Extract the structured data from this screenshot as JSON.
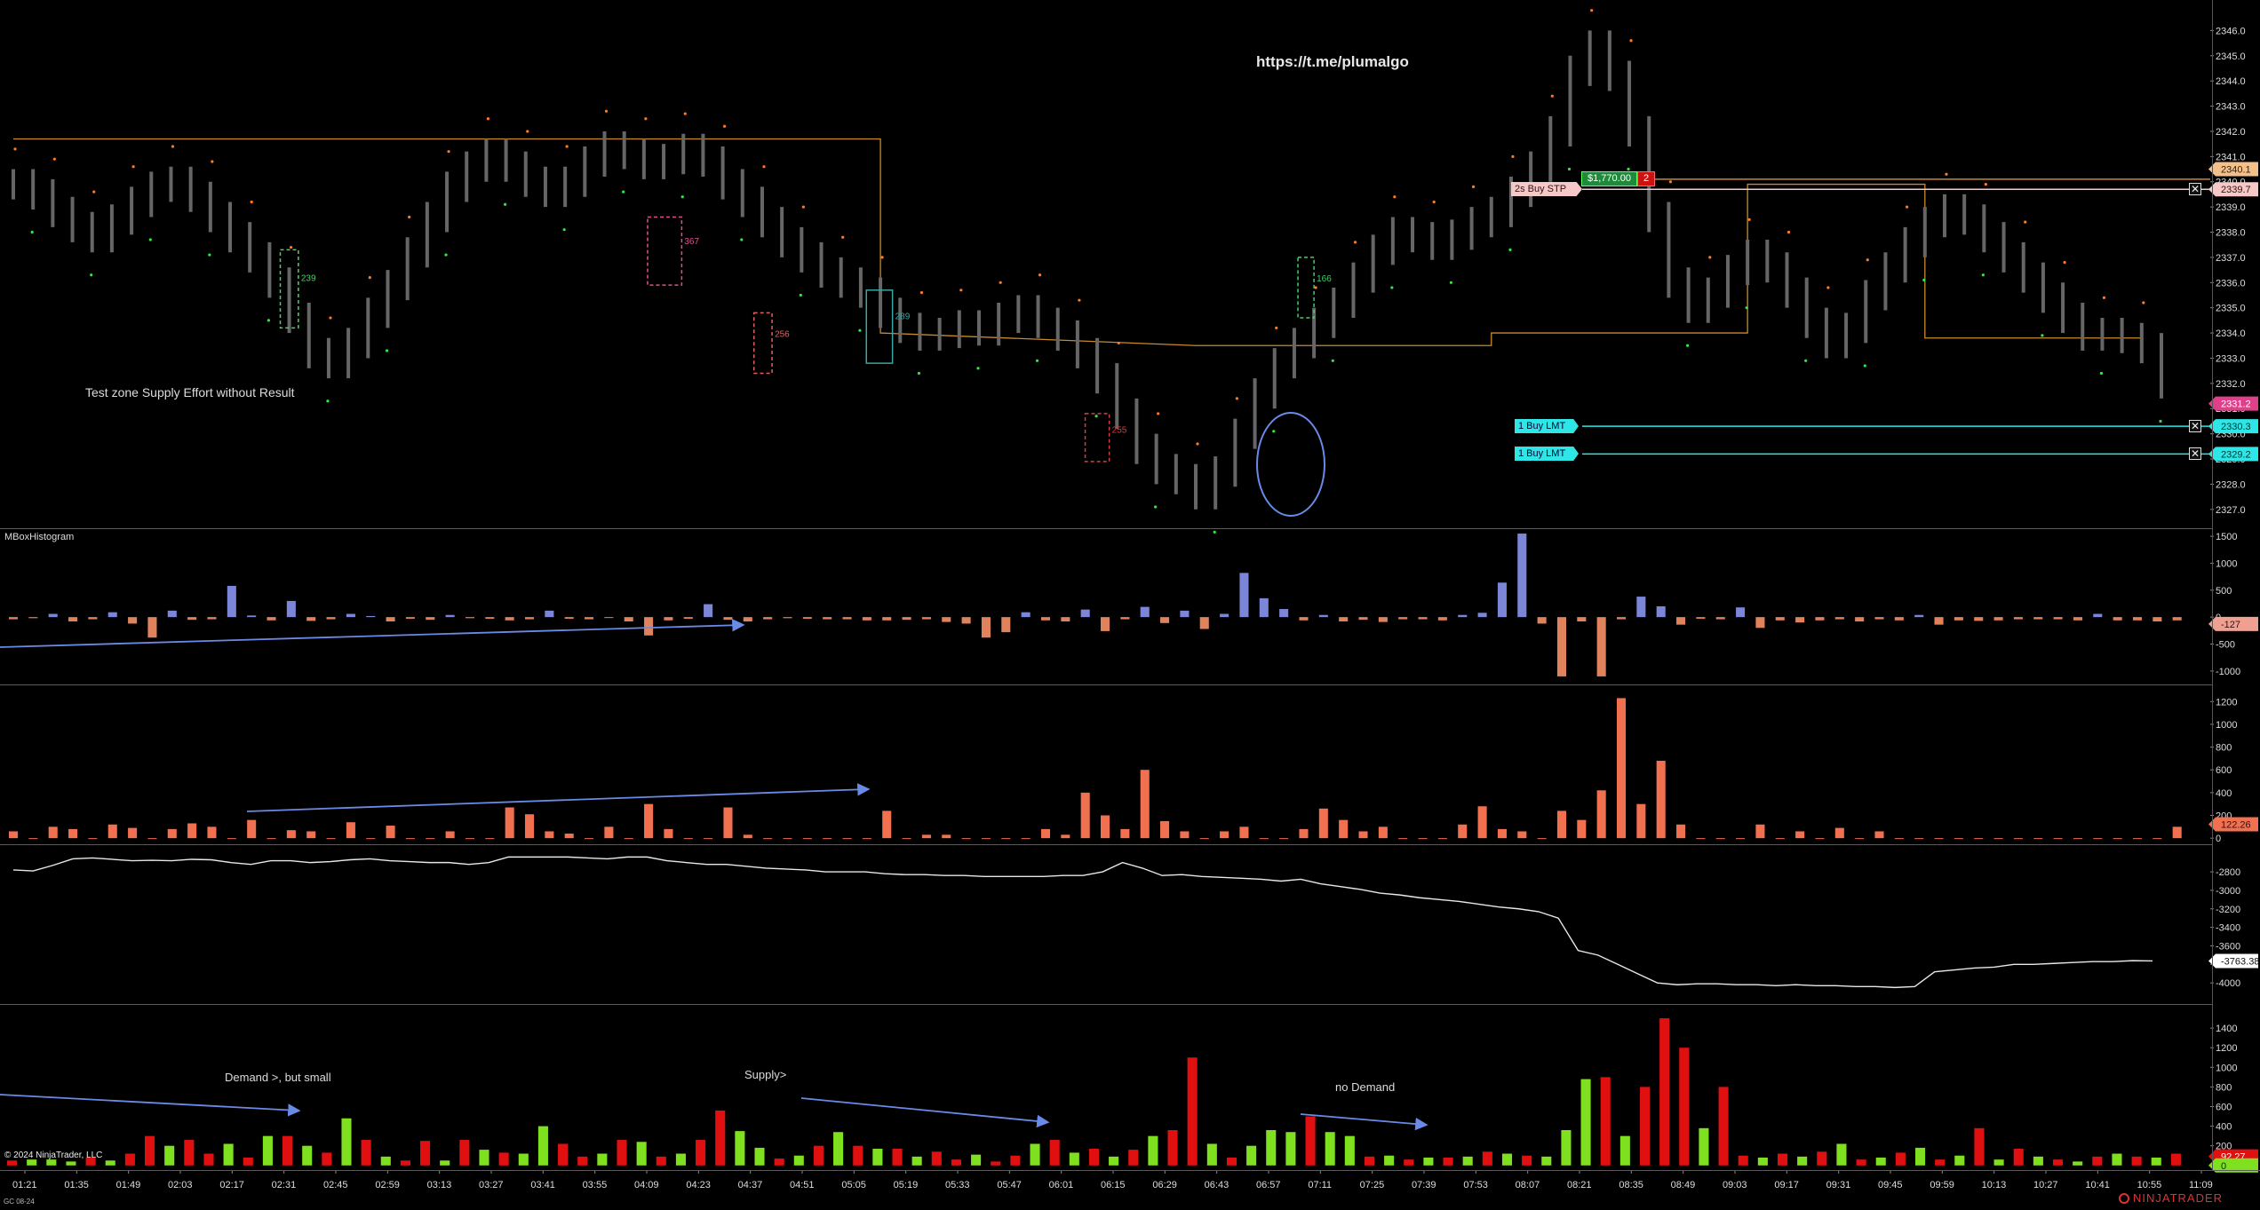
{
  "watermark_url": "https://t.me/plumalgo",
  "copyright": "© 2024 NinjaTrader, LLC",
  "brand": "NINJATRADER",
  "instrument": "GC 08-24",
  "annotations": {
    "test_zone": "Test zone Supply Effort without Result",
    "demand_small": "Demand >, but small",
    "supply": "Supply>",
    "no_demand": "no Demand"
  },
  "orders": {
    "buy_stp": {
      "label": "2s  Buy STP",
      "price": "2339.7"
    },
    "buy_lmt_1": {
      "label": "1  Buy LMT",
      "price": "2330.3"
    },
    "buy_lmt_2": {
      "label": "1  Buy LMT",
      "price": "2329.2"
    },
    "pnl": "$1,770.00",
    "qty": "2",
    "stop_tag": "2340.1",
    "last_tag": "2331.2",
    "close_symbol": "✕"
  },
  "colors": {
    "accent_green": "#7fe020",
    "accent_red": "#e01010",
    "delta_pos": "#7b86d8",
    "delta_neg": "#e0825c",
    "vol_bar": "#f07050",
    "order_cyan": "#2ee6e6",
    "level_line": "#c98a2a"
  },
  "chart_data": [
    {
      "type": "line",
      "panel": "price",
      "ylim": [
        2326.5,
        2347
      ],
      "y_ticks": [
        "2327.0",
        "2328.0",
        "2329.0",
        "2330.0",
        "2331.0",
        "2332.0",
        "2333.0",
        "2334.0",
        "2335.0",
        "2336.0",
        "2337.0",
        "2338.0",
        "2339.0",
        "2340.0",
        "2341.0",
        "2342.0",
        "2343.0",
        "2344.0",
        "2345.0",
        "2346.0"
      ],
      "x_ticks": [
        "01:21",
        "01:35",
        "01:49",
        "02:03",
        "02:17",
        "02:31",
        "02:45",
        "02:59",
        "03:13",
        "03:27",
        "03:41",
        "03:55",
        "04:09",
        "04:23",
        "04:37",
        "04:51",
        "05:05",
        "05:19",
        "05:33",
        "05:47",
        "06:01",
        "06:15",
        "06:29",
        "06:43",
        "06:57",
        "07:11",
        "07:25",
        "07:39",
        "07:53",
        "08:07",
        "08:21",
        "08:35",
        "08:49",
        "09:03",
        "09:17",
        "09:31",
        "09:45",
        "09:59",
        "10:13",
        "10:27",
        "10:41",
        "10:55",
        "11:09"
      ],
      "close": [
        2339.9,
        2339.5,
        2338.8,
        2338.2,
        2337.8,
        2338.5,
        2339.2,
        2339.8,
        2340.0,
        2339.4,
        2338.6,
        2337.8,
        2337.0,
        2336.0,
        2334.6,
        2333.2,
        2332.8,
        2333.6,
        2334.8,
        2335.9,
        2337.2,
        2338.6,
        2339.8,
        2340.6,
        2341.1,
        2340.6,
        2340.0,
        2339.6,
        2340.0,
        2340.8,
        2341.4,
        2341.1,
        2340.7,
        2340.9,
        2341.3,
        2340.8,
        2339.9,
        2339.2,
        2338.4,
        2337.6,
        2337.0,
        2336.4,
        2336.0,
        2335.6,
        2334.8,
        2334.2,
        2333.9,
        2334.0,
        2334.3,
        2334.1,
        2334.6,
        2334.9,
        2334.4,
        2333.9,
        2333.2,
        2332.2,
        2330.8,
        2329.4,
        2328.6,
        2328.2,
        2327.6,
        2328.5,
        2330.0,
        2331.6,
        2332.8,
        2333.6,
        2334.4,
        2335.2,
        2336.2,
        2337.3,
        2338.0,
        2337.8,
        2337.5,
        2337.9,
        2338.4,
        2338.8,
        2339.6,
        2340.6,
        2342.0,
        2344.4,
        2345.4,
        2344.2,
        2342.0,
        2338.6,
        2336.0,
        2335.0,
        2335.6,
        2336.5,
        2337.1,
        2336.6,
        2335.6,
        2334.4,
        2333.6,
        2334.2,
        2335.5,
        2336.6,
        2337.6,
        2338.4,
        2338.9,
        2338.5,
        2337.8,
        2337.0,
        2336.2,
        2335.4,
        2334.6,
        2333.9,
        2334.0,
        2333.8,
        2333.4,
        2332.0
      ],
      "level_line": [
        [
          0,
          2341.7
        ],
        [
          44,
          2341.7
        ],
        [
          44,
          2334.0
        ],
        [
          60,
          2333.5
        ],
        [
          75,
          2333.5
        ],
        [
          75,
          2334.0
        ],
        [
          88,
          2334.0
        ],
        [
          88,
          2339.9
        ],
        [
          97,
          2339.9
        ],
        [
          97,
          2333.8
        ],
        [
          108,
          2333.8
        ]
      ],
      "zones": [
        {
          "i0": 13.3,
          "i1": 14.2,
          "top": 2337.3,
          "bottom": 2334.2,
          "color": "#4bd06a",
          "label": "239",
          "dashed": true
        },
        {
          "i0": 31.6,
          "i1": 33.3,
          "top": 2338.6,
          "bottom": 2335.9,
          "color": "#e05090",
          "label": "367",
          "dashed": true
        },
        {
          "i0": 36.9,
          "i1": 37.8,
          "top": 2334.8,
          "bottom": 2332.4,
          "color": "#e06060",
          "label": "256",
          "dashed": true
        },
        {
          "i0": 42.5,
          "i1": 43.8,
          "top": 2335.7,
          "bottom": 2332.8,
          "color": "#3fa4a4",
          "label": "289",
          "dashed": false
        },
        {
          "i0": 53.4,
          "i1": 54.6,
          "top": 2330.8,
          "bottom": 2328.9,
          "color": "#d04040",
          "label": "255",
          "dashed": true
        },
        {
          "i0": 64.0,
          "i1": 64.8,
          "top": 2337.0,
          "bottom": 2334.6,
          "color": "#3fd06a",
          "label": "166",
          "dashed": true
        }
      ]
    },
    {
      "type": "bar",
      "panel": "MBoxHistogram",
      "title": "MBoxHistogram",
      "ylim": [
        -1200,
        1600
      ],
      "y_ticks": [
        "1500",
        "1000",
        "500",
        "0",
        "-500",
        "-1000"
      ],
      "last_value": "-127",
      "values": [
        -40,
        -20,
        60,
        -80,
        -40,
        90,
        -120,
        -380,
        120,
        -50,
        -40,
        580,
        30,
        -60,
        300,
        -70,
        -40,
        60,
        20,
        -80,
        -30,
        -50,
        40,
        -20,
        -30,
        -60,
        -40,
        120,
        -30,
        -40,
        -10,
        -80,
        -340,
        -60,
        -30,
        240,
        -50,
        -80,
        -40,
        -20,
        -30,
        -40,
        -40,
        -60,
        -60,
        -50,
        -40,
        -90,
        -120,
        -380,
        -280,
        90,
        -60,
        -80,
        140,
        -260,
        -40,
        190,
        -110,
        120,
        -220,
        60,
        820,
        350,
        150,
        -60,
        40,
        -80,
        -50,
        -90,
        -40,
        -40,
        -60,
        40,
        80,
        640,
        1550,
        -120,
        -1100,
        -80,
        -1100,
        -40,
        380,
        200,
        -140,
        -30,
        -40,
        180,
        -200,
        -60,
        -100,
        -60,
        -40,
        -80,
        -40,
        -60,
        40,
        -140,
        -60,
        -70,
        -60,
        -40,
        -40,
        -40,
        -60,
        60,
        -60,
        -60,
        -80,
        -60
      ]
    },
    {
      "type": "bar",
      "panel": "volume",
      "ylim": [
        -30,
        1280
      ],
      "y_ticks": [
        "1200",
        "1000",
        "800",
        "600",
        "400",
        "200",
        "0"
      ],
      "last_value": "122.26",
      "values": [
        60,
        0,
        100,
        80,
        0,
        120,
        90,
        0,
        80,
        130,
        100,
        0,
        160,
        0,
        70,
        60,
        0,
        140,
        0,
        110,
        0,
        0,
        60,
        0,
        0,
        270,
        210,
        60,
        40,
        0,
        100,
        0,
        300,
        80,
        0,
        0,
        270,
        30,
        0,
        0,
        0,
        0,
        0,
        0,
        240,
        0,
        30,
        30,
        0,
        0,
        0,
        0,
        80,
        30,
        400,
        200,
        80,
        600,
        150,
        60,
        0,
        60,
        100,
        0,
        0,
        80,
        260,
        160,
        60,
        100,
        0,
        0,
        0,
        120,
        280,
        80,
        60,
        0,
        240,
        160,
        420,
        1230,
        300,
        680,
        120,
        0,
        0,
        0,
        120,
        0,
        60,
        0,
        90,
        0,
        60,
        0,
        0,
        0,
        0,
        0,
        0,
        0,
        0,
        0,
        0,
        0,
        0,
        0,
        0,
        100
      ]
    },
    {
      "type": "line",
      "panel": "cumulative",
      "ylim": [
        -4200,
        -2550
      ],
      "y_ticks": [
        "-2800",
        "-3000",
        "-3200",
        "-3400",
        "-3600",
        "-3800",
        "-4000"
      ],
      "last_value": "-3763.38",
      "values": [
        -2780,
        -2790,
        -2730,
        -2660,
        -2650,
        -2665,
        -2680,
        -2675,
        -2680,
        -2665,
        -2670,
        -2700,
        -2720,
        -2680,
        -2680,
        -2700,
        -2690,
        -2670,
        -2660,
        -2680,
        -2690,
        -2700,
        -2700,
        -2720,
        -2700,
        -2640,
        -2640,
        -2640,
        -2640,
        -2650,
        -2660,
        -2640,
        -2640,
        -2680,
        -2700,
        -2720,
        -2720,
        -2740,
        -2760,
        -2770,
        -2780,
        -2800,
        -2800,
        -2800,
        -2820,
        -2830,
        -2830,
        -2840,
        -2840,
        -2850,
        -2850,
        -2850,
        -2850,
        -2840,
        -2840,
        -2800,
        -2700,
        -2760,
        -2840,
        -2830,
        -2850,
        -2860,
        -2870,
        -2880,
        -2900,
        -2880,
        -2930,
        -2960,
        -2990,
        -3030,
        -3050,
        -3080,
        -3100,
        -3120,
        -3150,
        -3180,
        -3200,
        -3230,
        -3300,
        -3650,
        -3700,
        -3800,
        -3900,
        -4000,
        -4020,
        -4010,
        -4010,
        -4020,
        -4020,
        -4030,
        -4020,
        -4030,
        -4030,
        -4040,
        -4040,
        -4050,
        -4040,
        -3880,
        -3860,
        -3840,
        -3830,
        -3800,
        -3800,
        -3790,
        -3780,
        -3770,
        -3770,
        -3760,
        -3763
      ]
    },
    {
      "type": "bar",
      "panel": "effort",
      "ylim": [
        -20,
        1600
      ],
      "y_ticks": [
        "1400",
        "1200",
        "1000",
        "800",
        "600",
        "400",
        "200",
        "0"
      ],
      "last_value": "92.27",
      "last_value_2": "0",
      "series": [
        {
          "values": [
            50,
            60,
            60,
            40,
            80,
            50,
            120,
            300,
            200,
            260,
            120,
            220,
            80,
            300,
            300,
            200,
            130,
            480,
            260,
            90,
            50,
            250,
            50,
            260,
            160,
            130,
            120,
            400,
            220,
            90,
            120,
            260,
            240,
            90,
            120,
            260,
            560,
            350,
            180,
            70,
            100,
            200,
            340,
            200,
            170,
            170,
            90,
            140,
            60,
            110,
            40,
            100,
            220,
            260,
            130,
            170,
            90,
            160,
            300,
            360,
            1100,
            220,
            80,
            200,
            360,
            340,
            500,
            340,
            300,
            90,
            100,
            60,
            80,
            80,
            90,
            140,
            120,
            100,
            90,
            360,
            880,
            900,
            300,
            800,
            1500,
            1200,
            380,
            800,
            100,
            80,
            120,
            90,
            140,
            220,
            60,
            80,
            130,
            180,
            60,
            100,
            380,
            60,
            170,
            90,
            60,
            40,
            90,
            120,
            90,
            80,
            120
          ]
        },
        {
          "colors": [
            "r",
            "g",
            "g",
            "g",
            "r",
            "g",
            "r",
            "r",
            "g",
            "r",
            "r",
            "g",
            "r",
            "g",
            "r",
            "g",
            "r",
            "g",
            "r",
            "g",
            "r",
            "r",
            "g",
            "r",
            "g",
            "r",
            "g",
            "g",
            "r",
            "r",
            "g",
            "r",
            "g",
            "r",
            "g",
            "r",
            "r",
            "g",
            "g",
            "r",
            "g",
            "r",
            "g",
            "r",
            "g",
            "r",
            "g",
            "r",
            "r",
            "g",
            "r",
            "r",
            "g",
            "r",
            "g",
            "r",
            "g",
            "r",
            "g",
            "r",
            "r",
            "g",
            "r",
            "g",
            "g",
            "g",
            "r",
            "g",
            "g",
            "r",
            "g",
            "r",
            "g",
            "r",
            "g",
            "r",
            "g",
            "r",
            "g",
            "g",
            "g",
            "r",
            "g",
            "r",
            "r",
            "r",
            "g",
            "r",
            "r",
            "g",
            "r",
            "g",
            "r",
            "g",
            "r",
            "g",
            "r",
            "g",
            "r",
            "g",
            "r",
            "g",
            "r",
            "g",
            "r",
            "g",
            "r",
            "g",
            "r",
            "g",
            "r"
          ]
        }
      ]
    }
  ]
}
